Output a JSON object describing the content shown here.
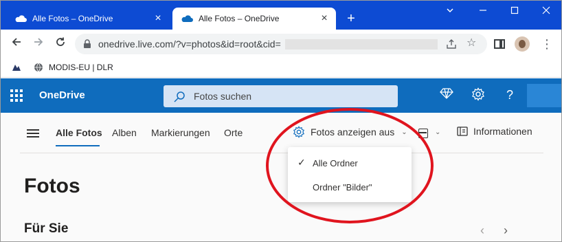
{
  "browser": {
    "tabs": [
      {
        "title": "Alle Fotos – OneDrive",
        "active": false
      },
      {
        "title": "Alle Fotos – OneDrive",
        "active": true
      }
    ],
    "new_tab": "+",
    "window_controls": {
      "minimize": "—",
      "maximize": "☐",
      "close": "✕"
    },
    "url": "onedrive.live.com/?v=photos&id=root&cid=",
    "bookmarks": [
      {
        "label": "MODIS-EU | DLR"
      }
    ]
  },
  "onedrive": {
    "brand": "OneDrive",
    "search_placeholder": "Fotos suchen",
    "header_icons": [
      "diamond-icon",
      "gear-icon",
      "help-icon"
    ],
    "pivots": [
      {
        "label": "Alle Fotos",
        "active": true
      },
      {
        "label": "Alben",
        "active": false
      },
      {
        "label": "Markierungen",
        "active": false
      },
      {
        "label": "Orte",
        "active": false
      }
    ],
    "view_by_label": "Fotos anzeigen aus",
    "info_label": "Informationen",
    "dropdown": {
      "items": [
        {
          "label": "Alle Ordner",
          "checked": true
        },
        {
          "label": "Ordner \"Bilder\"",
          "checked": false
        }
      ]
    },
    "page_title": "Fotos",
    "section_title": "Für Sie"
  },
  "colors": {
    "tabstrip": "#0d4bd3",
    "header": "#0f6cbd",
    "annotation": "#e0141e"
  }
}
